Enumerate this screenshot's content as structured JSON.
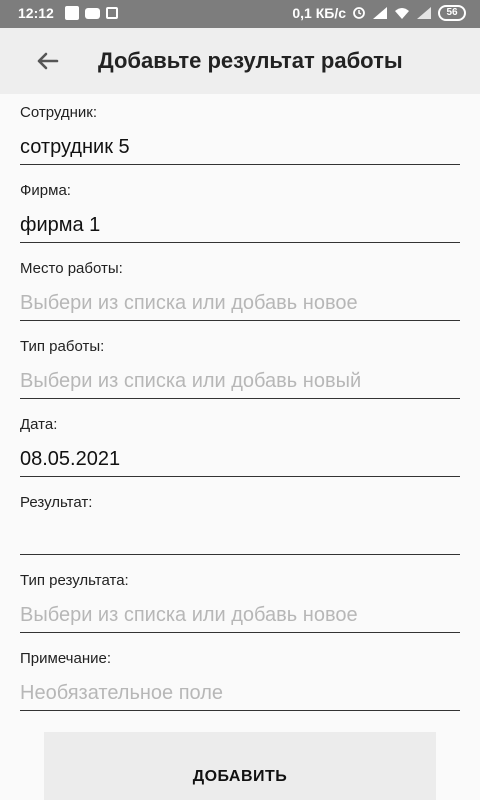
{
  "status": {
    "time": "12:12",
    "speed": "0,1 КБ/с",
    "battery": "56"
  },
  "appbar": {
    "title": "Добавьте результат работы"
  },
  "form": {
    "employee": {
      "label": "Сотрудник:",
      "value": "сотрудник 5"
    },
    "company": {
      "label": "Фирма:",
      "value": "фирма 1"
    },
    "workplace": {
      "label": "Место работы:",
      "placeholder": "Выбери из списка или добавь новое"
    },
    "work_type": {
      "label": "Тип работы:",
      "placeholder": "Выбери из списка или добавь новый"
    },
    "date": {
      "label": "Дата:",
      "value": "08.05.2021"
    },
    "result": {
      "label": "Результат:",
      "value": ""
    },
    "result_type": {
      "label": "Тип результата:",
      "placeholder": "Выбери из списка или добавь новое"
    },
    "note": {
      "label": "Примечание:",
      "placeholder": "Необязательное поле"
    }
  },
  "actions": {
    "add_label": "ДОБАВИТЬ"
  },
  "colors": {
    "statusbar": "#7d7d7d",
    "appbar": "#eeeeee",
    "background": "#fafafa",
    "placeholder": "#b7b7b7"
  },
  "icons": {
    "back": "back-arrow-icon"
  }
}
